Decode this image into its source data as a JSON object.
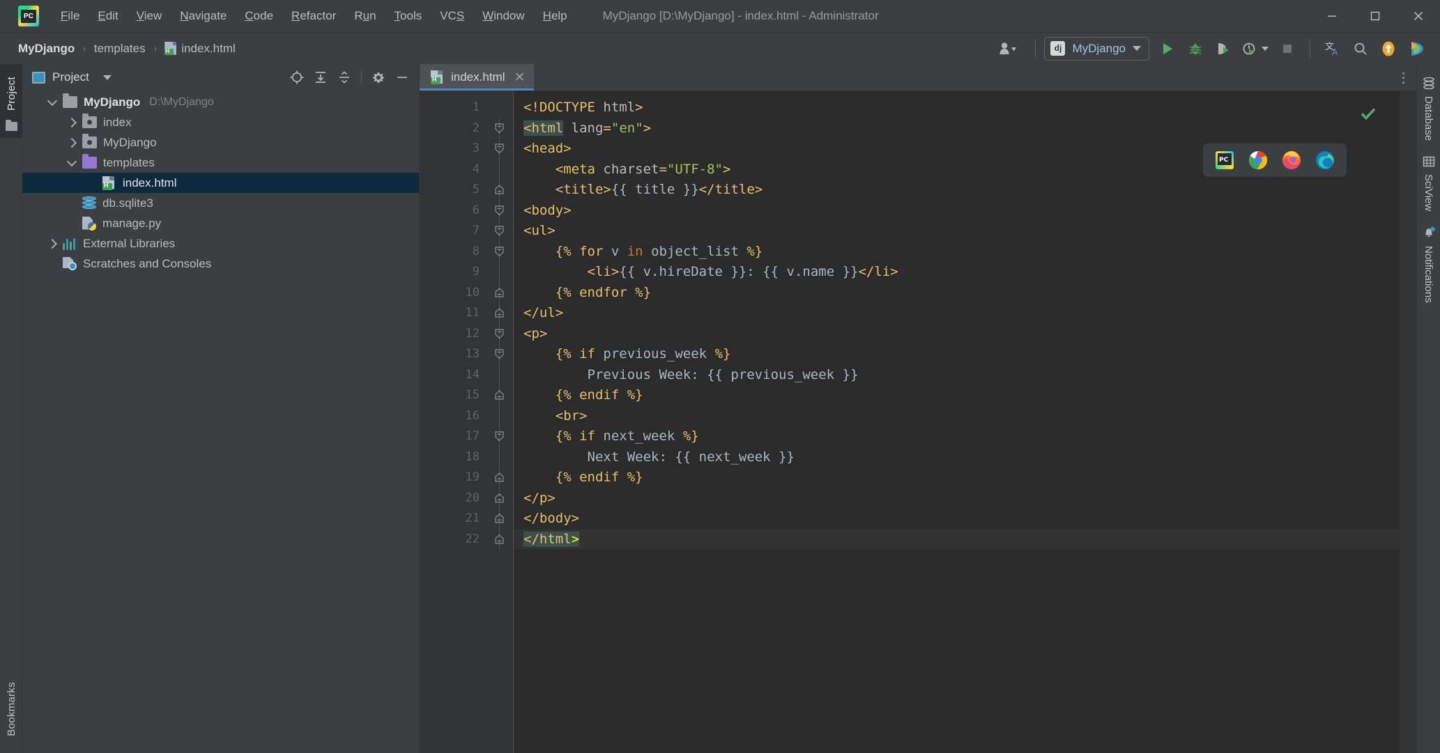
{
  "window": {
    "title": "MyDjango [D:\\MyDjango] - index.html - Administrator",
    "minimize_icon": "minimize-icon",
    "maximize_icon": "maximize-icon",
    "close_icon": "close-icon",
    "app_logo": "pycharm-logo-icon"
  },
  "menubar": {
    "items": [
      {
        "label": "File",
        "mnemonic": "F"
      },
      {
        "label": "Edit",
        "mnemonic": "E"
      },
      {
        "label": "View",
        "mnemonic": "V"
      },
      {
        "label": "Navigate",
        "mnemonic": "N"
      },
      {
        "label": "Code",
        "mnemonic": "C"
      },
      {
        "label": "Refactor",
        "mnemonic": "R"
      },
      {
        "label": "Run",
        "mnemonic": "u"
      },
      {
        "label": "Tools",
        "mnemonic": "T"
      },
      {
        "label": "VCS",
        "mnemonic": "S"
      },
      {
        "label": "Window",
        "mnemonic": "W"
      },
      {
        "label": "Help",
        "mnemonic": "H"
      }
    ]
  },
  "breadcrumb": {
    "items": [
      {
        "label": "MyDjango",
        "bold": true,
        "icon": null
      },
      {
        "label": "templates",
        "bold": false,
        "icon": null
      },
      {
        "label": "index.html",
        "bold": false,
        "icon": "html-file-icon"
      }
    ],
    "separator": "›"
  },
  "toolbar": {
    "account_icon": "user-account-icon",
    "run_config": {
      "label": "MyDjango",
      "icon": "django-icon",
      "dropdown_icon": "chevron-down-icon"
    },
    "buttons": [
      {
        "name": "run-button",
        "icon": "play-icon",
        "color": "#59a869"
      },
      {
        "name": "debug-button",
        "icon": "bug-icon",
        "color": "#499c54"
      },
      {
        "name": "run-coverage-button",
        "icon": "coverage-icon",
        "color": "#499c54"
      },
      {
        "name": "profile-button",
        "icon": "profile-icon",
        "color": "#499c54"
      },
      {
        "name": "stop-button",
        "icon": "stop-square-icon",
        "color": "#6e7174"
      },
      {
        "name": "translate-button",
        "icon": "translate-icon",
        "color": "#a9c7e8"
      },
      {
        "name": "search-everywhere-button",
        "icon": "search-icon",
        "color": "#b4b4b4"
      },
      {
        "name": "update-button",
        "icon": "arrow-up-circle-icon",
        "color": "#f0a732"
      },
      {
        "name": "codewithme-button",
        "icon": "codewithme-icon",
        "color": "#3592c4"
      }
    ]
  },
  "left_strip": {
    "project_tab": "Project",
    "bookmarks_tab": "Bookmarks",
    "folder_icon": "folder-icon"
  },
  "project_panel": {
    "title": "Project",
    "title_icon": "project-view-icon",
    "dropdown_icon": "chevron-down-icon",
    "tools": [
      {
        "name": "scroll-from-source-button",
        "icon": "target-icon"
      },
      {
        "name": "expand-all-button",
        "icon": "expand-all-icon"
      },
      {
        "name": "collapse-all-button",
        "icon": "collapse-all-icon"
      },
      {
        "name": "settings-button",
        "icon": "gear-icon"
      },
      {
        "name": "hide-button",
        "icon": "minus-icon"
      }
    ],
    "tree": [
      {
        "label": "MyDjango",
        "path": "D:\\MyDjango",
        "icon": "folder-icon",
        "indent": 0,
        "arrow": "open",
        "bold": true,
        "selected": false
      },
      {
        "label": "index",
        "path": "",
        "icon": "module-folder-icon",
        "indent": 1,
        "arrow": "closed",
        "bold": false,
        "selected": false
      },
      {
        "label": "MyDjango",
        "path": "",
        "icon": "module-folder-icon",
        "indent": 1,
        "arrow": "closed",
        "bold": false,
        "selected": false
      },
      {
        "label": "templates",
        "path": "",
        "icon": "templates-folder-icon",
        "indent": 1,
        "arrow": "open",
        "bold": false,
        "selected": false
      },
      {
        "label": "index.html",
        "path": "",
        "icon": "html-file-icon",
        "indent": 2,
        "arrow": "none",
        "bold": false,
        "selected": true
      },
      {
        "label": "db.sqlite3",
        "path": "",
        "icon": "database-file-icon",
        "indent": 1,
        "arrow": "none",
        "bold": false,
        "selected": false
      },
      {
        "label": "manage.py",
        "path": "",
        "icon": "python-file-icon",
        "indent": 1,
        "arrow": "none",
        "bold": false,
        "selected": false
      },
      {
        "label": "External Libraries",
        "path": "",
        "icon": "libraries-icon",
        "indent": 0,
        "arrow": "closed",
        "bold": false,
        "selected": false
      },
      {
        "label": "Scratches and Consoles",
        "path": "",
        "icon": "scratches-icon",
        "indent": 0,
        "arrow": "none",
        "bold": false,
        "selected": false
      }
    ]
  },
  "editor": {
    "tabs": [
      {
        "label": "index.html",
        "icon": "html-file-icon",
        "close_icon": "close-icon",
        "active": true
      }
    ],
    "more_icon": "more-options-icon",
    "inspection_status_icon": "checkmark-icon",
    "browser_popup": {
      "icons": [
        {
          "name": "pycharm-preview-icon",
          "label": "PyCharm"
        },
        {
          "name": "chrome-icon",
          "label": "Chrome"
        },
        {
          "name": "firefox-icon",
          "label": "Firefox"
        },
        {
          "name": "edge-icon",
          "label": "Edge"
        }
      ]
    },
    "run_gutter_icon": "python-run-icon",
    "lines": [
      {
        "n": "1",
        "fold": "none",
        "cur": false,
        "tokens": [
          {
            "t": "<!DOCTYPE ",
            "c": "t-tag"
          },
          {
            "t": "html",
            "c": "t-attr"
          },
          {
            "t": ">",
            "c": "t-tag"
          }
        ]
      },
      {
        "n": "2",
        "fold": "open",
        "cur": false,
        "tokens": [
          {
            "t": "<html",
            "c": "hl-tag t-tag"
          },
          {
            "t": " ",
            "c": "t-plain"
          },
          {
            "t": "lang",
            "c": "t-attr"
          },
          {
            "t": "=",
            "c": "t-tag"
          },
          {
            "t": "\"en\"",
            "c": "t-val"
          },
          {
            "t": ">",
            "c": "t-tag"
          }
        ]
      },
      {
        "n": "3",
        "fold": "open",
        "cur": false,
        "tokens": [
          {
            "t": "<head>",
            "c": "t-tag"
          }
        ]
      },
      {
        "n": "4",
        "fold": "bar",
        "cur": false,
        "tokens": [
          {
            "t": "    <meta ",
            "c": "t-tag"
          },
          {
            "t": "charset",
            "c": "t-attr"
          },
          {
            "t": "=",
            "c": "t-tag"
          },
          {
            "t": "\"UTF-8\"",
            "c": "t-val"
          },
          {
            "t": ">",
            "c": "t-tag"
          }
        ]
      },
      {
        "n": "5",
        "fold": "close",
        "cur": false,
        "tokens": [
          {
            "t": "    <title>",
            "c": "t-tag"
          },
          {
            "t": "{{ title }}",
            "c": "t-plain"
          },
          {
            "t": "</title>",
            "c": "t-tag"
          }
        ]
      },
      {
        "n": "6",
        "fold": "open",
        "cur": false,
        "tokens": [
          {
            "t": "<body>",
            "c": "t-tag"
          }
        ]
      },
      {
        "n": "7",
        "fold": "open",
        "cur": false,
        "tokens": [
          {
            "t": "<ul>",
            "c": "t-tag"
          }
        ]
      },
      {
        "n": "8",
        "fold": "open",
        "cur": false,
        "tokens": [
          {
            "t": "    {% ",
            "c": "t-dj"
          },
          {
            "t": "for",
            "c": "t-dj"
          },
          {
            "t": " v ",
            "c": "t-plain"
          },
          {
            "t": "in",
            "c": "t-kw"
          },
          {
            "t": " object_list ",
            "c": "t-plain"
          },
          {
            "t": "%}",
            "c": "t-dj"
          }
        ]
      },
      {
        "n": "9",
        "fold": "bar",
        "cur": false,
        "tokens": [
          {
            "t": "        <li>",
            "c": "t-tag"
          },
          {
            "t": "{{ v.hireDate }}: {{ v.name }}",
            "c": "t-plain"
          },
          {
            "t": "</li>",
            "c": "t-tag"
          }
        ]
      },
      {
        "n": "10",
        "fold": "close",
        "cur": false,
        "tokens": [
          {
            "t": "    {% ",
            "c": "t-dj"
          },
          {
            "t": "endfor",
            "c": "t-dj"
          },
          {
            "t": " %}",
            "c": "t-dj"
          }
        ]
      },
      {
        "n": "11",
        "fold": "close",
        "cur": false,
        "tokens": [
          {
            "t": "</ul>",
            "c": "t-tag"
          }
        ]
      },
      {
        "n": "12",
        "fold": "open",
        "cur": false,
        "tokens": [
          {
            "t": "<p>",
            "c": "t-tag"
          }
        ]
      },
      {
        "n": "13",
        "fold": "open",
        "cur": false,
        "tokens": [
          {
            "t": "    {% ",
            "c": "t-dj"
          },
          {
            "t": "if",
            "c": "t-dj"
          },
          {
            "t": " previous_week ",
            "c": "t-plain"
          },
          {
            "t": "%}",
            "c": "t-dj"
          }
        ]
      },
      {
        "n": "14",
        "fold": "bar",
        "cur": false,
        "tokens": [
          {
            "t": "        Previous Week: {{ previous_week }}",
            "c": "t-plain"
          }
        ]
      },
      {
        "n": "15",
        "fold": "close",
        "cur": false,
        "tokens": [
          {
            "t": "    {% ",
            "c": "t-dj"
          },
          {
            "t": "endif",
            "c": "t-dj"
          },
          {
            "t": " %}",
            "c": "t-dj"
          }
        ]
      },
      {
        "n": "16",
        "fold": "bar",
        "cur": false,
        "tokens": [
          {
            "t": "    <br>",
            "c": "t-tag"
          }
        ]
      },
      {
        "n": "17",
        "fold": "open",
        "cur": false,
        "tokens": [
          {
            "t": "    {% ",
            "c": "t-dj"
          },
          {
            "t": "if",
            "c": "t-dj"
          },
          {
            "t": " next_week ",
            "c": "t-plain"
          },
          {
            "t": "%}",
            "c": "t-dj"
          }
        ]
      },
      {
        "n": "18",
        "fold": "bar",
        "cur": false,
        "tokens": [
          {
            "t": "        Next Week: {{ next_week }}",
            "c": "t-plain"
          }
        ]
      },
      {
        "n": "19",
        "fold": "close",
        "cur": false,
        "tokens": [
          {
            "t": "    {% ",
            "c": "t-dj"
          },
          {
            "t": "endif",
            "c": "t-dj"
          },
          {
            "t": " %}",
            "c": "t-dj"
          }
        ]
      },
      {
        "n": "20",
        "fold": "close",
        "cur": false,
        "tokens": [
          {
            "t": "</p>",
            "c": "t-tag"
          }
        ]
      },
      {
        "n": "21",
        "fold": "close",
        "cur": false,
        "tokens": [
          {
            "t": "</body>",
            "c": "t-tag"
          }
        ]
      },
      {
        "n": "22",
        "fold": "close",
        "cur": true,
        "tokens": [
          {
            "t": "</html",
            "c": "hl-tag t-tag"
          },
          {
            "t": ">",
            "c": "hl-caret"
          }
        ]
      }
    ]
  },
  "right_strip": {
    "tabs": [
      {
        "label": "Database",
        "icon": "database-icon"
      },
      {
        "label": "SciView",
        "icon": "sciview-grid-icon"
      },
      {
        "label": "Notifications",
        "icon": "bell-icon",
        "badge": true
      }
    ]
  },
  "colors": {
    "accent": "#4a88c7",
    "selection": "#0d293e",
    "panel_bg": "#3c3f41",
    "editor_bg": "#2b2b2b",
    "gutter_bg": "#313335",
    "tag": "#e8bf6a",
    "string": "#a5c261",
    "keyword": "#cc7832",
    "text": "#a9b7c6",
    "tag_highlight": "#3b514d",
    "caret_yellow": "#ffff00",
    "run_green": "#59a869"
  }
}
